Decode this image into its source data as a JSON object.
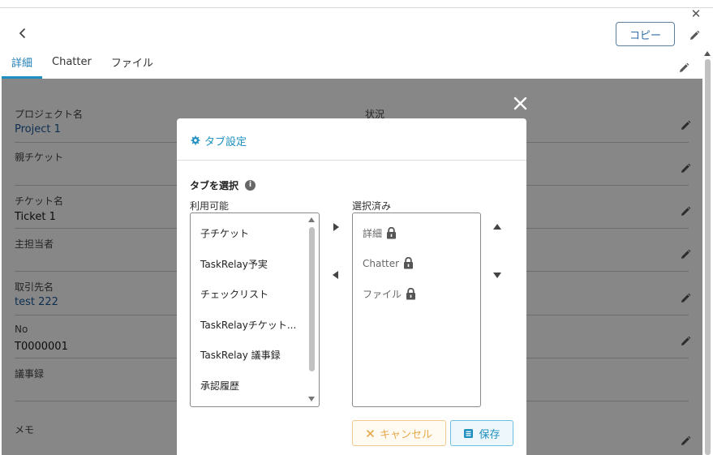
{
  "header": {
    "copy_label": "コピー"
  },
  "tabs": [
    {
      "label": "詳細"
    },
    {
      "label": "Chatter"
    },
    {
      "label": "ファイル"
    }
  ],
  "fields": {
    "project_label": "プロジェクト名",
    "project_value": "Project 1",
    "status_label": "状況",
    "parent_ticket_label": "親チケット",
    "ticket_name_label": "チケット名",
    "ticket_name_value": "Ticket 1",
    "assignee_label": "主担当者",
    "account_label": "取引先名",
    "account_value": "test 222",
    "no_label": "No",
    "no_value": "T0000001",
    "minutes_label": "議事録",
    "memo_label": "メモ"
  },
  "modal": {
    "title": "タブ設定",
    "section_title": "タブを選択",
    "available_label": "利用可能",
    "selected_label": "選択済み",
    "available_items": [
      "子チケット",
      "TaskRelay予実",
      "チェックリスト",
      "TaskRelayチケット...",
      "TaskRelay 議事録",
      "承認履歴"
    ],
    "selected_items": [
      "詳細",
      "Chatter",
      "ファイル"
    ],
    "cancel_label": "キャンセル",
    "save_label": "保存"
  },
  "colors": {
    "accent": "#1e8fc0",
    "link": "#1c5a9c",
    "cancel": "#e8a94c"
  }
}
